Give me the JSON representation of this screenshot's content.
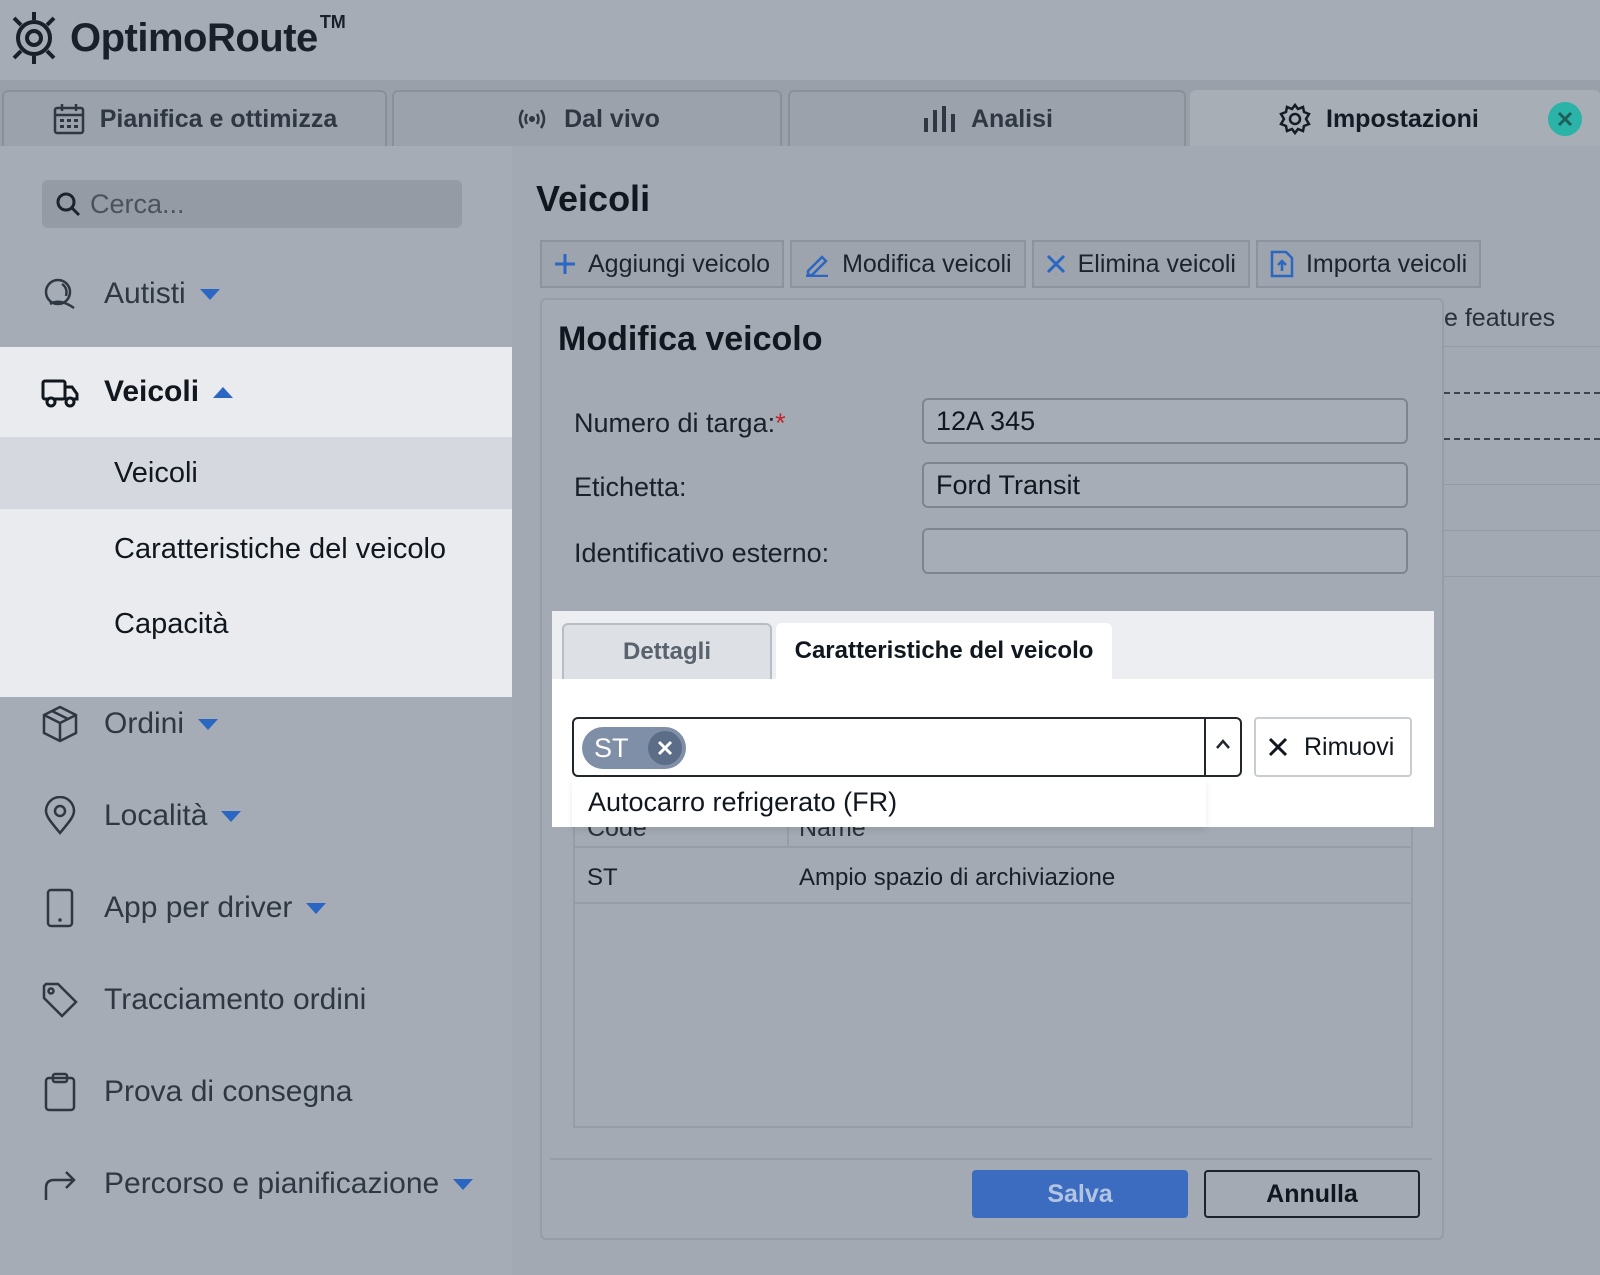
{
  "app": {
    "name": "OptimoRoute",
    "trademark": "TM"
  },
  "tabs": [
    {
      "label": "Pianifica e ottimizza",
      "icon": "calendar-icon"
    },
    {
      "label": "Dal vivo",
      "icon": "broadcast-icon"
    },
    {
      "label": "Analisi",
      "icon": "bar-chart-icon"
    },
    {
      "label": "Impostazioni",
      "icon": "gear-icon",
      "active": true
    }
  ],
  "sidebar": {
    "search_placeholder": "Cerca...",
    "items": [
      {
        "label": "Autisti",
        "icon": "driver-icon",
        "expandable": true
      },
      {
        "label": "Veicoli",
        "icon": "truck-icon",
        "expanded": true
      },
      {
        "label": "Ordini",
        "icon": "box-icon",
        "expandable": true
      },
      {
        "label": "Località",
        "icon": "location-pin-icon",
        "expandable": true
      },
      {
        "label": "App per driver",
        "icon": "phone-icon",
        "expandable": true
      },
      {
        "label": "Tracciamento ordini",
        "icon": "tag-icon"
      },
      {
        "label": "Prova di consegna",
        "icon": "clipboard-icon"
      },
      {
        "label": "Percorso e pianificazione",
        "icon": "route-arrow-icon",
        "expandable": true
      }
    ],
    "subitems": [
      "Veicoli",
      "Caratteristiche del veicolo",
      "Capacità"
    ]
  },
  "main": {
    "title": "Veicoli",
    "toolbar": {
      "add": "Aggiungi veicolo",
      "edit": "Modifica veicoli",
      "delete": "Elimina veicoli",
      "import": "Importa veicoli"
    },
    "background_text": "e features"
  },
  "modal": {
    "title": "Modifica veicolo",
    "fields": {
      "plate_label": "Numero di targa:",
      "plate_required": "*",
      "plate_value": "12A 345",
      "label_label": "Etichetta:",
      "label_value": "Ford Transit",
      "external_label": "Identificativo esterno:",
      "external_value": ""
    },
    "tabs": {
      "details": "Dettagli",
      "features": "Caratteristiche del veicolo"
    },
    "selected_chip": "ST",
    "dropdown_option": "Autocarro refrigerato (FR)",
    "remove_label": "Rimuovi",
    "table": {
      "headers": [
        "Code",
        "Name"
      ],
      "rows": [
        {
          "code": "ST",
          "name": "Ampio spazio di archiviazione"
        }
      ]
    },
    "save": "Salva",
    "cancel": "Annulla"
  },
  "colors": {
    "accent": "#2b66c2",
    "close": "#2bb3a7",
    "save_button": "#3b6cc0"
  }
}
